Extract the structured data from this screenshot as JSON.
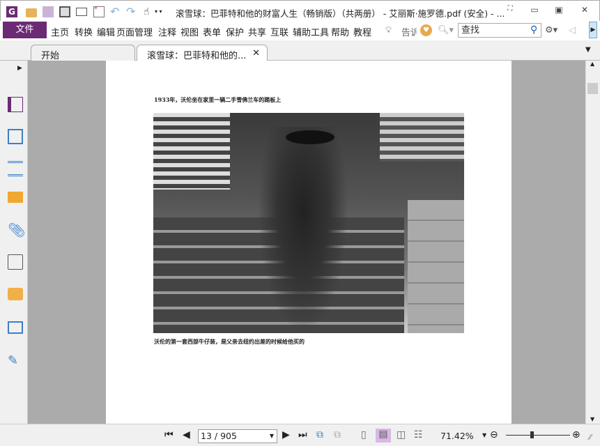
{
  "titlebar": {
    "title": "滚雪球：巴菲特和他的财富人生（畅销版）（共两册） - 艾丽斯·施罗德.pdf (安全) - ...",
    "quick_access": [
      "app-logo-icon",
      "open-folder-icon",
      "save-icon",
      "print-icon",
      "email-icon",
      "new-icon",
      "undo-icon",
      "redo-icon",
      "hand-tool-icon",
      "customize-dropdown-icon"
    ],
    "window_controls": [
      "fullscreen-icon",
      "minimize-icon",
      "maximize-icon",
      "close-icon"
    ]
  },
  "menu": {
    "file_label": "文件",
    "items": [
      "主页",
      "转换",
      "编辑",
      "页面管理",
      "注释",
      "视图",
      "表单",
      "保护",
      "共享",
      "互联",
      "辅助工具",
      "帮助",
      "教程"
    ],
    "tell_me": "告诉",
    "search_placeholder": "查找"
  },
  "tabs": [
    {
      "label": "开始",
      "active": false
    },
    {
      "label": "滚雪球：巴菲特和他的...",
      "active": true
    }
  ],
  "sidebar": {
    "icons": [
      "bookmark-icon",
      "pages-icon",
      "layers-icon",
      "comments-icon",
      "attachments-icon",
      "signature-icon",
      "security-lock-icon",
      "fields-icon",
      "certificate-icon"
    ]
  },
  "document": {
    "caption_top": "1933年，沃伦坐在家里一辆二手雪佛兰车的踏板上",
    "caption_bottom": "沃伦的第一套西部牛仔装，是父亲去纽约出差的时候给他买的"
  },
  "statusbar": {
    "page_value": "13 / 905",
    "zoom": "71.42%",
    "zoom_slider_fraction": 0.4,
    "accent": "#6b2a74"
  }
}
